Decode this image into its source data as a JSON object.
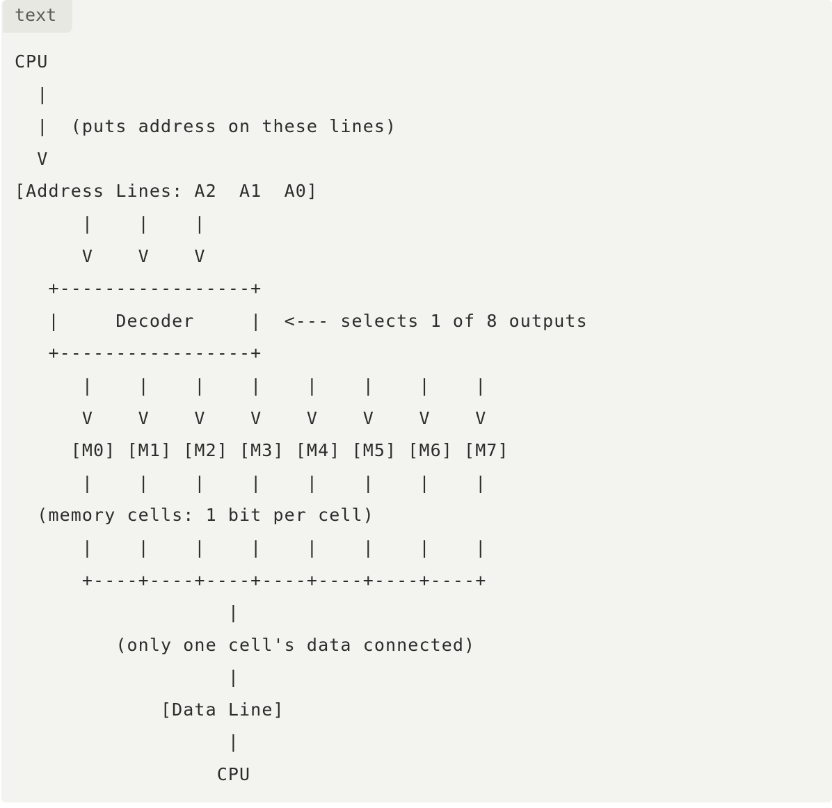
{
  "code_block": {
    "language": "text",
    "lines": [
      "CPU",
      "  |",
      "  |  (puts address on these lines)",
      "  V",
      "[Address Lines: A2  A1  A0]",
      "      |    |    |",
      "      V    V    V",
      "   +-----------------+",
      "   |     Decoder     |  <--- selects 1 of 8 outputs",
      "   +-----------------+",
      "      |    |    |    |    |    |    |    |",
      "      V    V    V    V    V    V    V    V",
      "     [M0] [M1] [M2] [M3] [M4] [M5] [M6] [M7]",
      "      |    |    |    |    |    |    |    |",
      "  (memory cells: 1 bit per cell)",
      "      |    |    |    |    |    |    |    |",
      "      +----+----+----+----+----+----+----+",
      "                   |",
      "         (only one cell's data connected)",
      "                   |",
      "             [Data Line]",
      "                   |",
      "                  CPU"
    ]
  }
}
